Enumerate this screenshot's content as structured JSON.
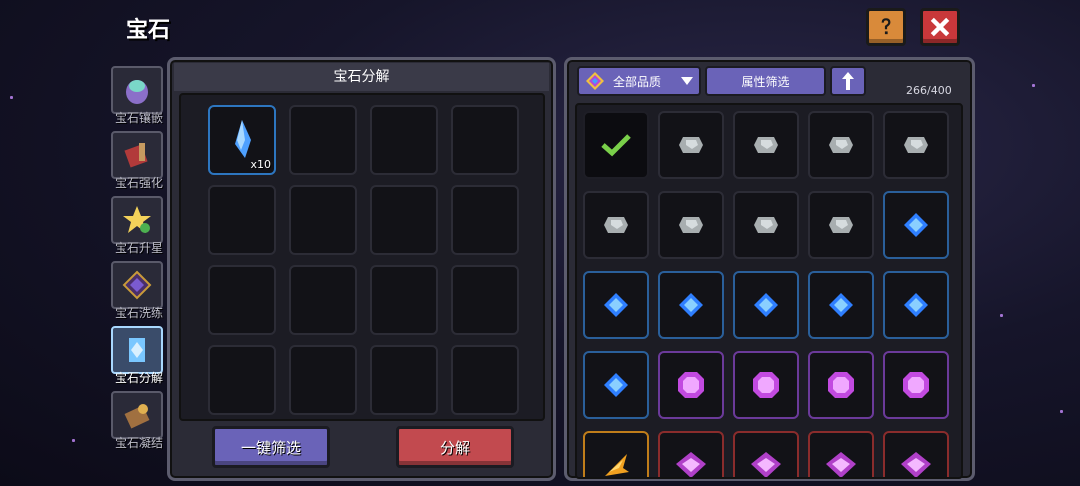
{
  "title": "宝石",
  "tabs": [
    {
      "label": "宝石镶嵌",
      "icon": "gem-inlay-icon",
      "active": false
    },
    {
      "label": "宝石强化",
      "icon": "gem-upgrade-icon",
      "active": false
    },
    {
      "label": "宝石升星",
      "icon": "star-icon",
      "active": false
    },
    {
      "label": "宝石洗练",
      "icon": "gem-reroll-icon",
      "active": false
    },
    {
      "label": "宝石分解",
      "icon": "gem-decompose-icon",
      "active": true
    },
    {
      "label": "宝石凝结",
      "icon": "gem-condense-icon",
      "active": false
    }
  ],
  "decompose_panel": {
    "header": "宝石分解",
    "slots": [
      {
        "item": "blue-crystal",
        "count": "x10"
      }
    ],
    "filter_button": "一键筛选",
    "decompose_button": "分解"
  },
  "inventory": {
    "quality_dropdown": "全部品质",
    "attribute_filter": "属性筛选",
    "capacity": "266/400",
    "rows": [
      [
        "check",
        "gray",
        "gray",
        "gray",
        "gray"
      ],
      [
        "gray",
        "gray",
        "gray",
        "gray",
        "blue"
      ],
      [
        "blue",
        "blue",
        "blue",
        "blue",
        "blue"
      ],
      [
        "blue",
        "purple",
        "purple",
        "purple",
        "purple"
      ],
      [
        "gold",
        "red",
        "red",
        "red",
        "red"
      ]
    ]
  },
  "colors": {
    "accent": "#6a63b8",
    "danger": "#c24a4f",
    "blue_gem": "#3a8cff",
    "purple_gem": "#d070ff"
  }
}
